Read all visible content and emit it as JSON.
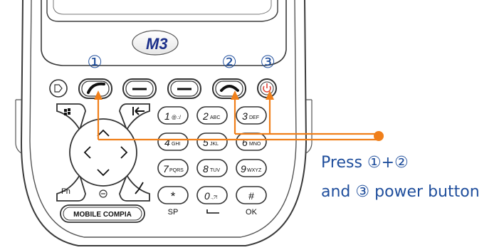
{
  "device": {
    "logo_text": "M3",
    "brand_label": "MOBILE COMPIA",
    "markers": {
      "one": "①",
      "two": "②",
      "three": "③"
    },
    "keys": {
      "k1": "1",
      "k1_sub": "@.:/",
      "k2": "2",
      "k2_sub": "ABC",
      "k3": "3",
      "k3_sub": "DEF",
      "k4": "4",
      "k4_sub": "GHI",
      "k5": "5",
      "k5_sub": "JKL",
      "k6": "6",
      "k6_sub": "MNO",
      "k7": "7",
      "k7_sub": "PQRS",
      "k8": "8",
      "k8_sub": "TUV",
      "k9": "9",
      "k9_sub": "WXYZ",
      "kstar": "*",
      "k0": "0",
      "k0_sub": ".,?!",
      "khash": "#",
      "fn": "Fn",
      "sp": "SP",
      "ok": "OK"
    }
  },
  "callout": {
    "line1": "Press ①+②",
    "line2": "and ③ power button"
  },
  "colors": {
    "arrow": "#f07f1a",
    "text": "#1f4e9c",
    "logo": "#1b2f8a",
    "power": "#e0453a"
  }
}
